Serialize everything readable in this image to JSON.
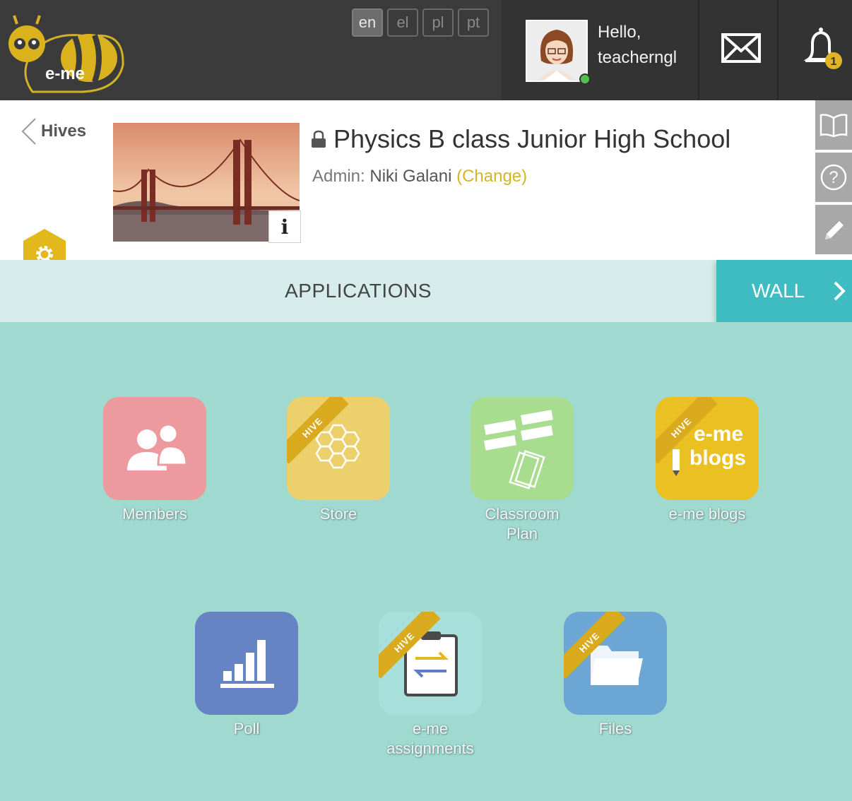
{
  "logo": {
    "text": "e-me"
  },
  "languages": [
    {
      "code": "en",
      "active": true
    },
    {
      "code": "el",
      "active": false
    },
    {
      "code": "pl",
      "active": false
    },
    {
      "code": "pt",
      "active": false
    }
  ],
  "user": {
    "greeting": "Hello,",
    "username": "teacherngl",
    "status_color": "#4fc14c"
  },
  "notifications": {
    "count": "1",
    "icon": "bell-icon"
  },
  "messages": {
    "icon": "mail-icon"
  },
  "back": {
    "label": "Hives"
  },
  "hive": {
    "title": "Physics B class Junior High School",
    "admin_label": "Admin:",
    "admin_name": "Niki Galani",
    "change_label": "(Change)",
    "info_label": "i"
  },
  "tabs": {
    "applications": "APPLICATIONS",
    "wall": "WALL"
  },
  "side_tools": [
    "book-icon",
    "help-icon",
    "edit-icon"
  ],
  "apps": [
    {
      "label": "Members",
      "color": "#ec9a9e",
      "hive": false,
      "icon": "members-icon"
    },
    {
      "label": "Store",
      "color": "#ecd06c",
      "hive": true,
      "icon": "honeycomb-icon"
    },
    {
      "label": "Classroom Plan",
      "color": "#a8dc8f",
      "hive": false,
      "icon": "classroom-plan-icon"
    },
    {
      "label": "e-me blogs",
      "color": "#ebc023",
      "hive": true,
      "icon": "blogs-icon",
      "tile_text_1": "e-me",
      "tile_text_2": "blogs"
    },
    {
      "label": "Poll",
      "color": "#6683c4",
      "hive": false,
      "icon": "poll-icon"
    },
    {
      "label": "e-me assignments",
      "color": "#a7e0da",
      "hive": true,
      "icon": "assignments-icon"
    },
    {
      "label": "Files",
      "color": "#6ca6d4",
      "hive": true,
      "icon": "folder-icon"
    }
  ],
  "ribbon_text": "HIVE",
  "colors": {
    "accent_yellow": "#d6b522",
    "wall_tab": "#3fbcc1",
    "topbar": "#3b3b3b",
    "background": "#9fd9cf"
  }
}
